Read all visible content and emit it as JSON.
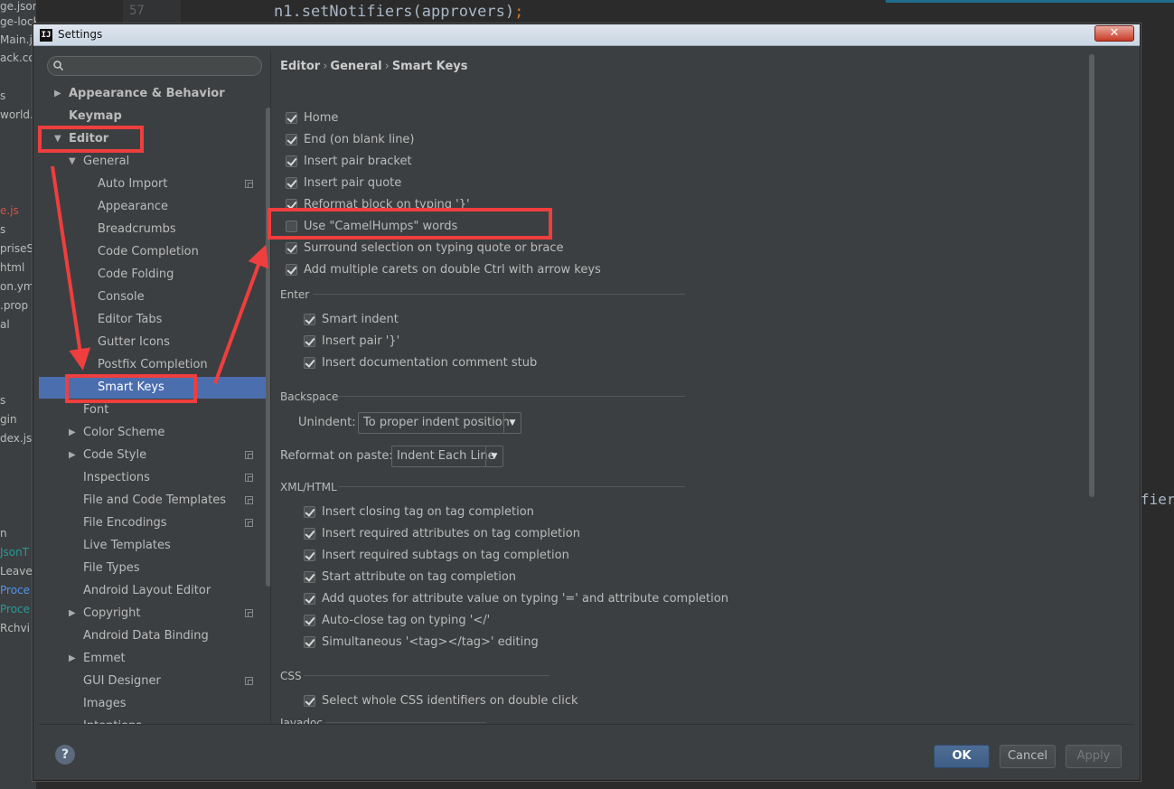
{
  "background": {
    "files": [
      {
        "text": "ge.json",
        "style": ""
      },
      {
        "text": "ge-lock.json",
        "style": ""
      },
      {
        "text": "Main.js",
        "style": ""
      },
      {
        "text": "ack.co",
        "style": ""
      },
      {
        "text": "s",
        "style": ""
      },
      {
        "text": "world.b",
        "style": ""
      },
      {
        "text": "e.js",
        "style": "red"
      },
      {
        "text": "s",
        "style": ""
      },
      {
        "text": "priseS",
        "style": ""
      },
      {
        "text": "html",
        "style": ""
      },
      {
        "text": "on.yml",
        "style": ""
      },
      {
        "text": ".prop",
        "style": ""
      },
      {
        "text": "al",
        "style": ""
      },
      {
        "text": "s",
        "style": ""
      },
      {
        "text": "gin",
        "style": ""
      },
      {
        "text": "dex.jsp",
        "style": ""
      },
      {
        "text": "n",
        "style": ""
      },
      {
        "text": "JsonT",
        "style": "cyan"
      },
      {
        "text": "Leave",
        "style": ""
      },
      {
        "text": "Proce",
        "style": "blue"
      },
      {
        "text": "Proce",
        "style": "cyan"
      },
      {
        "text": "Rchvi",
        "style": ""
      }
    ],
    "line_number": "57",
    "code_text": "n1.setNotifiers(approvers)",
    "code_semicolon": ";",
    "right_text": "fier"
  },
  "dialog": {
    "title": "Settings",
    "logo_text": "IJ",
    "close_label": "✕"
  },
  "sidebar": {
    "search_placeholder": "",
    "items": [
      {
        "label": "Appearance & Behavior",
        "indent": 0,
        "arrow": "right",
        "bold": true,
        "selected": false,
        "copy": false
      },
      {
        "label": "Keymap",
        "indent": 0,
        "arrow": "",
        "bold": true,
        "selected": false,
        "copy": false
      },
      {
        "label": "Editor",
        "indent": 0,
        "arrow": "down",
        "bold": true,
        "selected": false,
        "copy": false
      },
      {
        "label": "General",
        "indent": 1,
        "arrow": "down",
        "bold": false,
        "selected": false,
        "copy": false
      },
      {
        "label": "Auto Import",
        "indent": 2,
        "arrow": "",
        "bold": false,
        "selected": false,
        "copy": true
      },
      {
        "label": "Appearance",
        "indent": 2,
        "arrow": "",
        "bold": false,
        "selected": false,
        "copy": false
      },
      {
        "label": "Breadcrumbs",
        "indent": 2,
        "arrow": "",
        "bold": false,
        "selected": false,
        "copy": false
      },
      {
        "label": "Code Completion",
        "indent": 2,
        "arrow": "",
        "bold": false,
        "selected": false,
        "copy": false
      },
      {
        "label": "Code Folding",
        "indent": 2,
        "arrow": "",
        "bold": false,
        "selected": false,
        "copy": false
      },
      {
        "label": "Console",
        "indent": 2,
        "arrow": "",
        "bold": false,
        "selected": false,
        "copy": false
      },
      {
        "label": "Editor Tabs",
        "indent": 2,
        "arrow": "",
        "bold": false,
        "selected": false,
        "copy": false
      },
      {
        "label": "Gutter Icons",
        "indent": 2,
        "arrow": "",
        "bold": false,
        "selected": false,
        "copy": false
      },
      {
        "label": "Postfix Completion",
        "indent": 2,
        "arrow": "",
        "bold": false,
        "selected": false,
        "copy": false
      },
      {
        "label": "Smart Keys",
        "indent": 2,
        "arrow": "",
        "bold": false,
        "selected": true,
        "copy": false
      },
      {
        "label": "Font",
        "indent": 1,
        "arrow": "",
        "bold": false,
        "selected": false,
        "copy": false
      },
      {
        "label": "Color Scheme",
        "indent": 1,
        "arrow": "right",
        "bold": false,
        "selected": false,
        "copy": false
      },
      {
        "label": "Code Style",
        "indent": 1,
        "arrow": "right",
        "bold": false,
        "selected": false,
        "copy": true
      },
      {
        "label": "Inspections",
        "indent": 1,
        "arrow": "",
        "bold": false,
        "selected": false,
        "copy": true
      },
      {
        "label": "File and Code Templates",
        "indent": 1,
        "arrow": "",
        "bold": false,
        "selected": false,
        "copy": true
      },
      {
        "label": "File Encodings",
        "indent": 1,
        "arrow": "",
        "bold": false,
        "selected": false,
        "copy": true
      },
      {
        "label": "Live Templates",
        "indent": 1,
        "arrow": "",
        "bold": false,
        "selected": false,
        "copy": false
      },
      {
        "label": "File Types",
        "indent": 1,
        "arrow": "",
        "bold": false,
        "selected": false,
        "copy": false
      },
      {
        "label": "Android Layout Editor",
        "indent": 1,
        "arrow": "",
        "bold": false,
        "selected": false,
        "copy": false
      },
      {
        "label": "Copyright",
        "indent": 1,
        "arrow": "right",
        "bold": false,
        "selected": false,
        "copy": true
      },
      {
        "label": "Android Data Binding",
        "indent": 1,
        "arrow": "",
        "bold": false,
        "selected": false,
        "copy": false
      },
      {
        "label": "Emmet",
        "indent": 1,
        "arrow": "right",
        "bold": false,
        "selected": false,
        "copy": false
      },
      {
        "label": "GUI Designer",
        "indent": 1,
        "arrow": "",
        "bold": false,
        "selected": false,
        "copy": true
      },
      {
        "label": "Images",
        "indent": 1,
        "arrow": "",
        "bold": false,
        "selected": false,
        "copy": false
      },
      {
        "label": "Intentions",
        "indent": 1,
        "arrow": "",
        "bold": false,
        "selected": false,
        "copy": false
      }
    ]
  },
  "breadcrumb": [
    "Editor",
    "General",
    "Smart Keys"
  ],
  "breadcrumb_sep": "›",
  "options_main": [
    {
      "label": "Home",
      "checked": true
    },
    {
      "label": "End (on blank line)",
      "checked": true
    },
    {
      "label": "Insert pair bracket",
      "checked": true
    },
    {
      "label": "Insert pair quote",
      "checked": true
    },
    {
      "label": "Reformat block on typing '}'",
      "checked": true
    },
    {
      "label": "Use \"CamelHumps\" words",
      "checked": false
    },
    {
      "label": "Surround selection on typing quote or brace",
      "checked": true
    },
    {
      "label": "Add multiple carets on double Ctrl with arrow keys",
      "checked": true
    }
  ],
  "enter": {
    "title": "Enter",
    "options": [
      {
        "label": "Smart indent",
        "checked": true
      },
      {
        "label": "Insert pair '}'",
        "checked": true
      },
      {
        "label": "Insert documentation comment stub",
        "checked": true
      }
    ]
  },
  "backspace": {
    "title": "Backspace",
    "unindent_label": "Unindent:",
    "unindent_value": "To proper indent position",
    "reformat_label": "Reformat on paste:",
    "reformat_value": "Indent Each Line"
  },
  "xml_html": {
    "title": "XML/HTML",
    "options": [
      {
        "label": "Insert closing tag on tag completion",
        "checked": true
      },
      {
        "label": "Insert required attributes on tag completion",
        "checked": true
      },
      {
        "label": "Insert required subtags on tag completion",
        "checked": true
      },
      {
        "label": "Start attribute on tag completion",
        "checked": true
      },
      {
        "label": "Add quotes for attribute value on typing '=' and attribute completion",
        "checked": true
      },
      {
        "label": "Auto-close tag on typing '</'",
        "checked": true
      },
      {
        "label": "Simultaneous '<tag></tag>' editing",
        "checked": true
      }
    ]
  },
  "css": {
    "title": "CSS",
    "options": [
      {
        "label": "Select whole CSS identifiers on double click",
        "checked": true
      }
    ]
  },
  "javadoc": {
    "title": "Javadoc"
  },
  "footer": {
    "help_label": "?",
    "ok_label": "OK",
    "cancel_label": "Cancel",
    "apply_label": "Apply"
  },
  "colors": {
    "selection": "#4b6eaf",
    "annotation": "#ef3e3e",
    "ok_button": "#4d6d95"
  }
}
